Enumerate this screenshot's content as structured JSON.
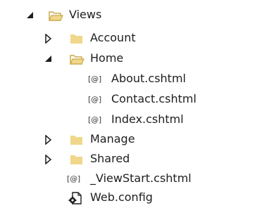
{
  "colors": {
    "folder_fill": "#F0D78A",
    "folder_edge": "#C9A94B",
    "expander": "#1e1e1e",
    "text": "#1e1e1e"
  },
  "icons": {
    "razor_glyph": "[@]"
  },
  "tree": {
    "views": {
      "label": "Views",
      "expanded": true,
      "icon": "folder-open-icon"
    },
    "account": {
      "label": "Account",
      "expanded": false,
      "icon": "folder-icon"
    },
    "home": {
      "label": "Home",
      "expanded": true,
      "icon": "folder-open-icon"
    },
    "about": {
      "label": "About.cshtml",
      "icon": "razor-file-icon"
    },
    "contact": {
      "label": "Contact.cshtml",
      "icon": "razor-file-icon"
    },
    "index": {
      "label": "Index.cshtml",
      "icon": "razor-file-icon"
    },
    "manage": {
      "label": "Manage",
      "expanded": false,
      "icon": "folder-icon"
    },
    "shared": {
      "label": "Shared",
      "expanded": false,
      "icon": "folder-icon"
    },
    "viewstart": {
      "label": "_ViewStart.cshtml",
      "icon": "razor-file-icon"
    },
    "webconfig": {
      "label": "Web.config",
      "icon": "config-file-icon"
    }
  }
}
